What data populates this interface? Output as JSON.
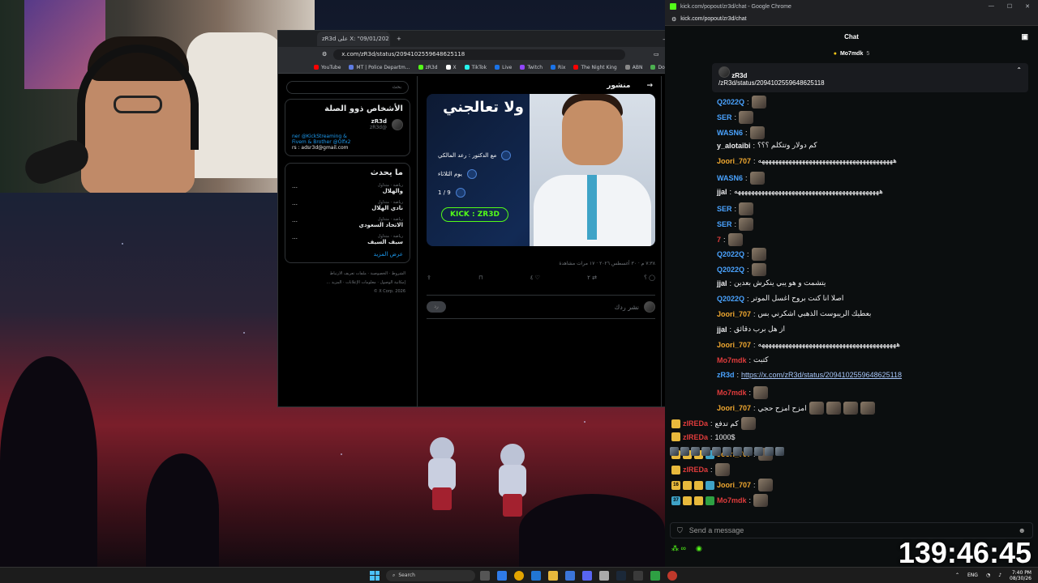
{
  "desktop": {
    "wallpaper_desc_colors": [
      "#11182a",
      "#7a1e2a",
      "#140a10"
    ]
  },
  "xwindow": {
    "tab_title": "zR3d على X: \"09/01/202",
    "url": "x.com/zR3d/status/2094102559648625118",
    "bookmarks": [
      "YouTube",
      "MT | Police Departm...",
      "zR3d",
      "X",
      "TikTok",
      "Live",
      "Twitch",
      "Rix",
      "The Night King",
      "ABN",
      "DokanTIP"
    ],
    "search_placeholder": "بحث",
    "people_title": "الأشخاص ذوو الصلة",
    "profile_name": "zR3d",
    "profile_handle": "@zR3d",
    "bio_line1": "ner @KickStreaming &",
    "bio_line2": "Fivem & Brother @Olfx2",
    "bio_line3": "rs : adsr3d@gmail.com",
    "trending_title": "ما يحدث",
    "trends": [
      {
        "cat": "رياضة · متداول",
        "name": "والهلال"
      },
      {
        "cat": "رياضة · متداول",
        "name": "نادي الهلال"
      },
      {
        "cat": "رياضة · متداول",
        "name": "الاتحاد السعودي"
      },
      {
        "cat": "رياضة · متداول",
        "name": "سيف السيف"
      }
    ],
    "show_more": "عرض المزيد",
    "footer": [
      "الشروط",
      "الخصوصية",
      "ملفات تعريف الارتباط",
      "إمكانية الوصول",
      "معلومات الإعلانات",
      "المزيد ...",
      "X Corp. 2026 ©"
    ],
    "post_header": "منشور",
    "post_title": "ولا تعالجني",
    "post_row1": "مع الدكتور : رعد المالكي",
    "post_row2": "يوم الثلاثاء",
    "post_row3": "9 / 1",
    "kick_label": "KICK : ZR3D",
    "post_meta": "٧:٣٨ م · ٣٠ أغسطس ٢٠٢٦ · ١٧ مرات مشاهدة",
    "actions": [
      "؟",
      "٢",
      "٤",
      "",
      ""
    ],
    "reply_placeholder": "نشر ردك",
    "reply_button": "رد"
  },
  "chat": {
    "window_title": "kick.com/popout/zr3d/chat - Google Chrome",
    "url": "kick.com/popout/zr3d/chat",
    "header": "Chat",
    "pinned_user": "Mo7mdk",
    "pinned_count": "5",
    "pin_user": "zR3d",
    "pin_link": "/zR3d/status/2094102559648625118",
    "messages": [
      {
        "user": "Q2022Q",
        "color": "#4aa3ff",
        "text": "",
        "emote": true
      },
      {
        "user": "SER",
        "color": "#4aa3ff",
        "text": "",
        "emote": true
      },
      {
        "user": "WASN6",
        "color": "#4aa3ff",
        "text": "",
        "emote": true
      },
      {
        "user": "y_alotaibi",
        "color": "#efeff1",
        "text": "كم دولار وتتكلم ؟؟؟",
        "emote": false
      },
      {
        "user": "Joori_707",
        "color": "#f0a830",
        "text": "ههههههههههههههههههههههههههههههههههههههههه",
        "emote": false
      },
      {
        "user": "WASN6",
        "color": "#4aa3ff",
        "text": "",
        "emote": true
      },
      {
        "user": "jjal",
        "color": "#efeff1",
        "text": "هههههههههههههههههههههههههههههههههههههههههههه",
        "emote": false
      },
      {
        "user": "SER",
        "color": "#4aa3ff",
        "text": "",
        "emote": true
      },
      {
        "user": "SER",
        "color": "#4aa3ff",
        "text": "",
        "emote": true
      },
      {
        "user": "7",
        "color": "#e03c3c",
        "text": "",
        "emote": true
      },
      {
        "user": "Q2022Q",
        "color": "#4aa3ff",
        "text": "",
        "emote": true
      },
      {
        "user": "Q2022Q",
        "color": "#4aa3ff",
        "text": "",
        "emote": true
      },
      {
        "user": "jjal",
        "color": "#efeff1",
        "text": "يتشمت و هو يبي ينكرش بعدين",
        "emote": false
      },
      {
        "user": "Q2022Q",
        "color": "#4aa3ff",
        "text": "اصلا انا كنت بروح اغسل الموتر",
        "emote": false
      },
      {
        "user": "Joori_707",
        "color": "#f0a830",
        "text": "بعطيك الريبوست الذهبي اشكرني بس",
        "emote": false
      },
      {
        "user": "jjal",
        "color": "#efeff1",
        "text": "از هل برب دقائق",
        "emote": false
      },
      {
        "user": "Joori_707",
        "color": "#f0a830",
        "text": "هههههههههههههههههههههههههههههههههههههههههه",
        "emote": false
      },
      {
        "user": "Mo7mdk",
        "color": "#e03c3c",
        "text": "كتبت",
        "emote": false
      },
      {
        "user": "zR3d",
        "color": "#4aa3ff",
        "text": "https://x.com/zR3d/status/2094102559648625118",
        "emote": false,
        "link": true
      },
      {
        "user": "Mo7mdk",
        "color": "#e03c3c",
        "text": "",
        "emote": true
      },
      {
        "user": "Joori_707",
        "color": "#f0a830",
        "text": "امزح امزح حجي",
        "emote": false,
        "emotes": 4
      },
      {
        "user": "zIREDa",
        "color": "#e03c3c",
        "text": "كم تدفع",
        "emote": true,
        "badges": [
          "crown"
        ]
      },
      {
        "user": "zIREDa",
        "color": "#e03c3c",
        "text": "1000$",
        "emote": false,
        "badges": [
          "crown"
        ]
      },
      {
        "user": "Joori_707",
        "color": "#f0a830",
        "text": "",
        "emote": true,
        "badges": [
          "16",
          "crown",
          "coin",
          "star"
        ]
      },
      {
        "user": "zIREDa",
        "color": "#e03c3c",
        "text": "",
        "emote": true,
        "badges": [
          "crown"
        ]
      },
      {
        "user": "Joori_707",
        "color": "#f0a830",
        "text": "",
        "emote": true,
        "badges": [
          "16",
          "crown",
          "coin",
          "star"
        ]
      },
      {
        "user": "Mo7mdk",
        "color": "#e03c3c",
        "text": "",
        "emote": true,
        "badges": [
          "37",
          "crown",
          "coin",
          "mod"
        ]
      }
    ],
    "input_placeholder": "Send a message",
    "footer_count": "∞"
  },
  "timer": "139:46:45",
  "taskbar": {
    "search": "Search",
    "lang": "ENG",
    "time": "7:40 PM",
    "date": "08/30/26"
  }
}
